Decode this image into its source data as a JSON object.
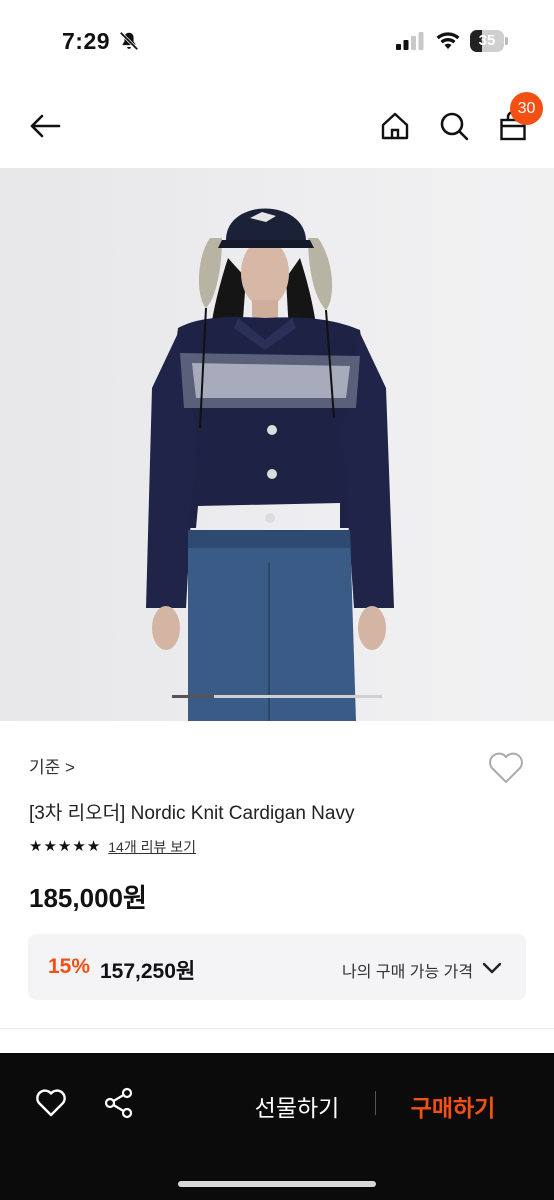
{
  "status_bar": {
    "time": "7:29",
    "battery": "35",
    "battery_level": 0.35
  },
  "header": {
    "cart_count": "30",
    "icons": [
      "back-arrow-icon",
      "home-icon",
      "search-icon",
      "shopping-bag-icon"
    ]
  },
  "gallery": {
    "image_description_icon": "product-photo",
    "slide_progress": 0.2
  },
  "product": {
    "brand_link": "기준 >",
    "name": "[3차 리오더] Nordic Knit Cardigan Navy",
    "stars": [
      "★",
      "★",
      "★",
      "★",
      "★"
    ],
    "review_link": "14개 리뷰 보기",
    "price": "185,000원",
    "discount": {
      "percent": "15%",
      "price": "157,250원",
      "label": "나의 구매 가능 가격"
    }
  },
  "bottom_bar": {
    "gift_label": "선물하기",
    "buy_label": "구매하기"
  },
  "colors": {
    "accent": "#f45014",
    "bottom_bar_bg": "#0b0b0b",
    "discount_box_bg": "#f4f4f6"
  }
}
